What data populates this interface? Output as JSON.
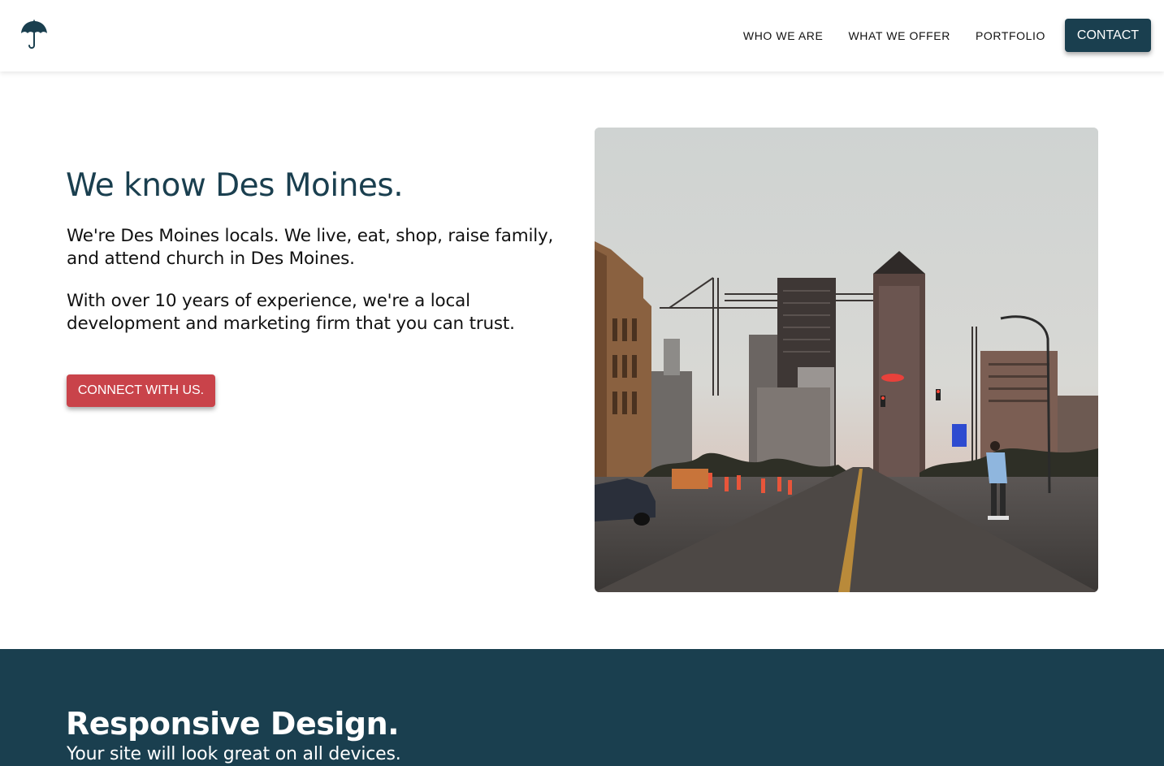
{
  "header": {
    "logo_icon": "umbrella-icon",
    "nav": {
      "who_we_are": "WHO WE ARE",
      "what_we_offer": "WHAT WE OFFER",
      "portfolio": "PORTFOLIO",
      "contact": "CONTACT"
    }
  },
  "hero": {
    "title": "We know Des Moines.",
    "paragraph1": "We're Des Moines locals. We live, eat, shop, raise family, and attend church in Des Moines.",
    "paragraph2": "With over 10 years of experience, we're a local development and marketing firm that you can trust.",
    "cta_label": "CONNECT WITH US."
  },
  "section": {
    "title": "Responsive Design.",
    "subtitle": "Your site will look great on all devices."
  },
  "colors": {
    "brand_dark": "#1a3f4f",
    "accent_red": "#c9434a"
  }
}
